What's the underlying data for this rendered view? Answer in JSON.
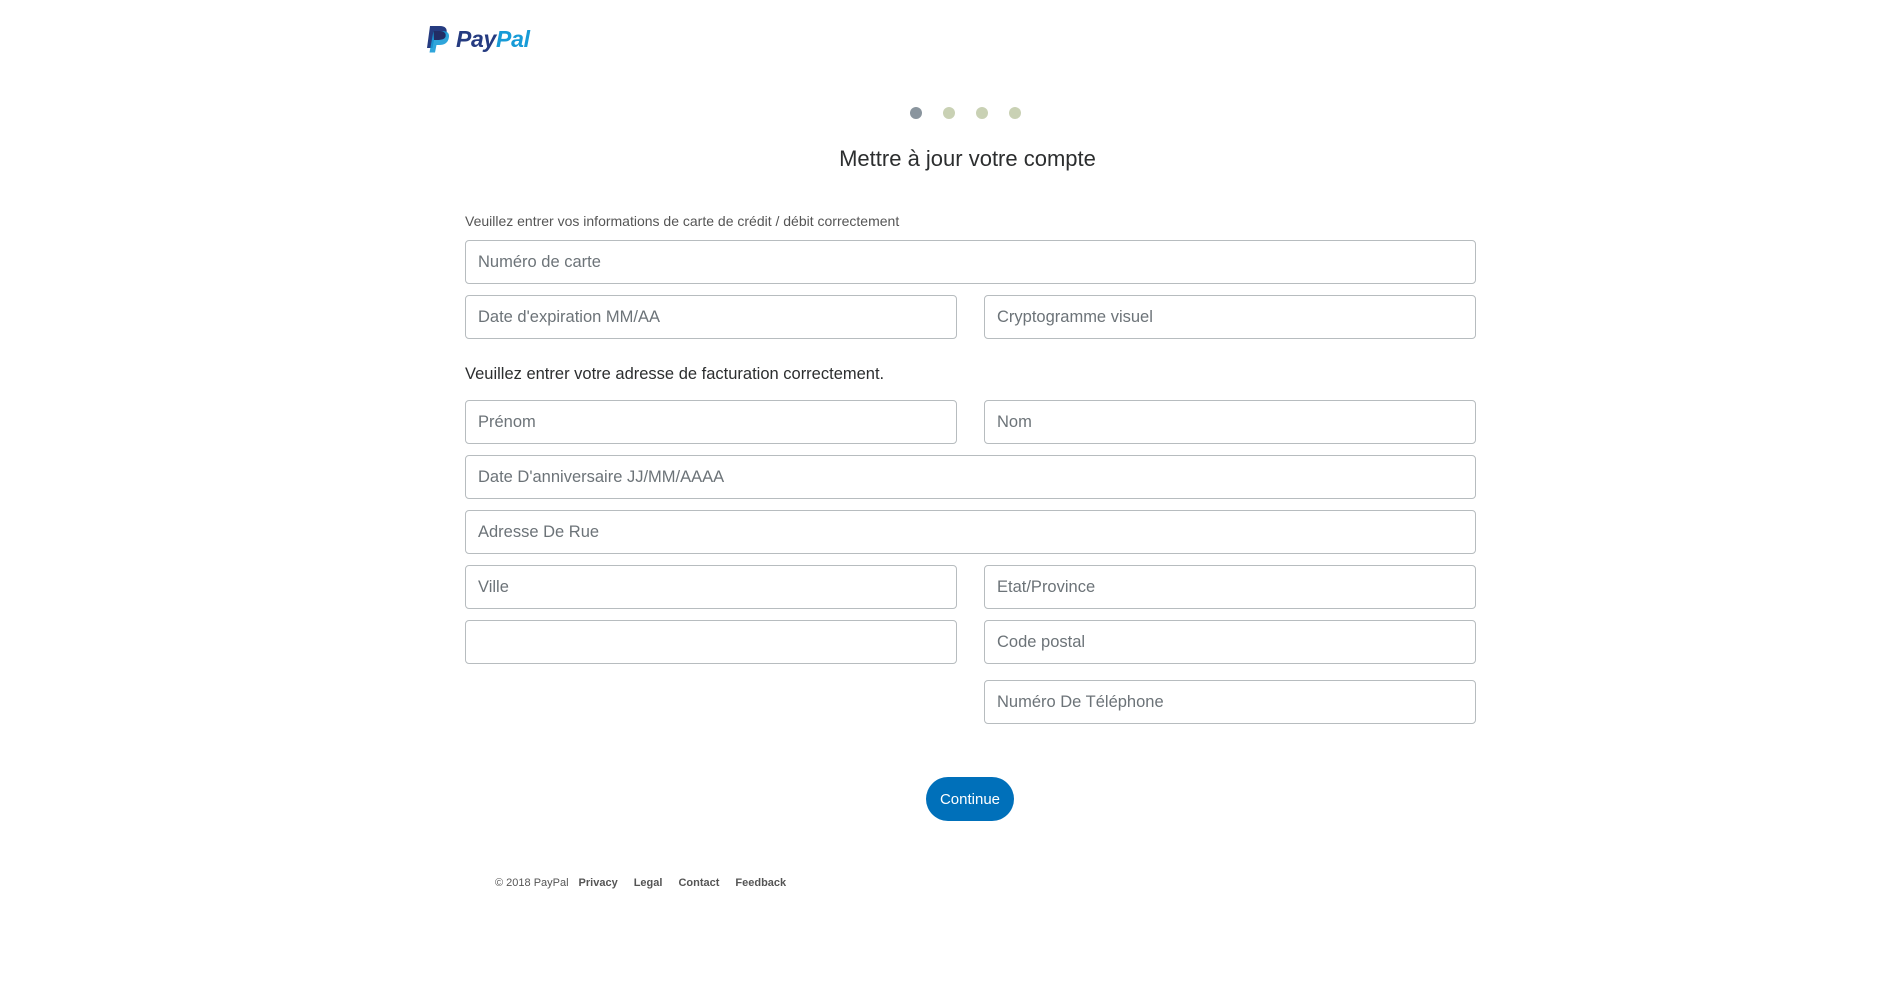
{
  "brand": {
    "logo_alt": "PayPal",
    "logo_part1": "Pay",
    "logo_part2": "Pal",
    "colors": {
      "dark_blue": "#253b80",
      "light_blue": "#179bd7",
      "button": "#0070ba"
    }
  },
  "progress": {
    "total_steps": 4,
    "current_step": 1
  },
  "title": "Mettre à jour votre compte",
  "card_section": {
    "hint": "Veuillez entrer vos informations de carte de crédit / débit correctement",
    "card_number_placeholder": "Numéro de carte",
    "expiry_placeholder": "Date d'expiration MM/AA",
    "cvv_placeholder": "Cryptogramme visuel"
  },
  "billing_section": {
    "hint": "Veuillez entrer votre adresse de facturation correctement.",
    "first_name_placeholder": "Prénom",
    "last_name_placeholder": "Nom",
    "birthdate_placeholder": "Date D'anniversaire JJ/MM/AAAA",
    "street_placeholder": "Adresse De Rue",
    "city_placeholder": "Ville",
    "state_placeholder": "Etat/Province",
    "country_value": "",
    "postal_placeholder": "Code postal",
    "phone_placeholder": "Numéro De Téléphone"
  },
  "continue_label": "Continue",
  "footer": {
    "copyright": "© 2018 PayPal",
    "links": [
      "Privacy",
      "Legal",
      "Contact",
      "Feedback"
    ]
  }
}
